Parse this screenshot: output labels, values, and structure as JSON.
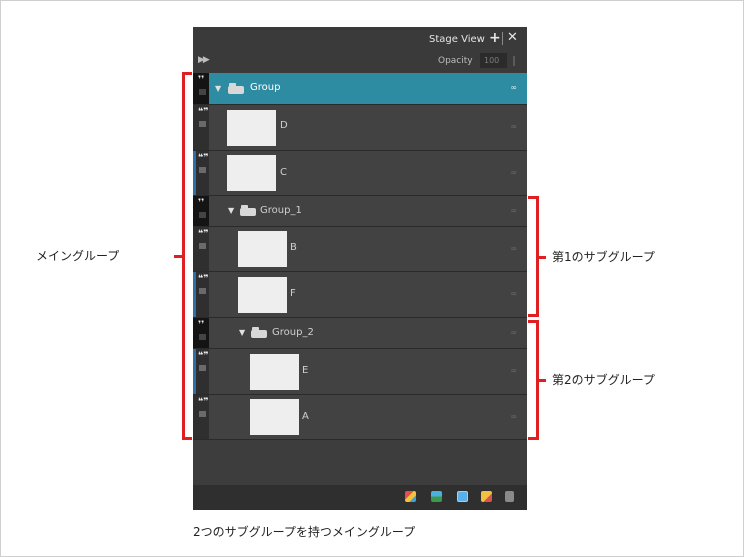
{
  "panel": {
    "view_label": "Stage View",
    "opacity_label": "Opacity",
    "opacity_value": "100",
    "rows": [
      {
        "type": "group",
        "name": "Group",
        "selected": true
      },
      {
        "type": "layer",
        "name": "D"
      },
      {
        "type": "layer",
        "name": "C"
      },
      {
        "type": "group",
        "name": "Group_1"
      },
      {
        "type": "layer",
        "name": "B"
      },
      {
        "type": "layer",
        "name": "F"
      },
      {
        "type": "group",
        "name": "Group_2"
      },
      {
        "type": "layer",
        "name": "E"
      },
      {
        "type": "layer",
        "name": "A"
      }
    ],
    "bottom_icons": [
      "add-layer-icon",
      "add-drawing-layer-icon",
      "duplicate-icon",
      "add-group-icon",
      "trash-icon"
    ]
  },
  "annotations": {
    "main_group": "メイングループ",
    "sub_group_1": "第1のサブグループ",
    "sub_group_2": "第2のサブグループ"
  },
  "caption": "2つのサブグループを持つメイングループ",
  "colors": {
    "selected_row": "#2d8ba2",
    "bracket": "#e02020",
    "layer_color_bar": "#2f6fa8"
  }
}
